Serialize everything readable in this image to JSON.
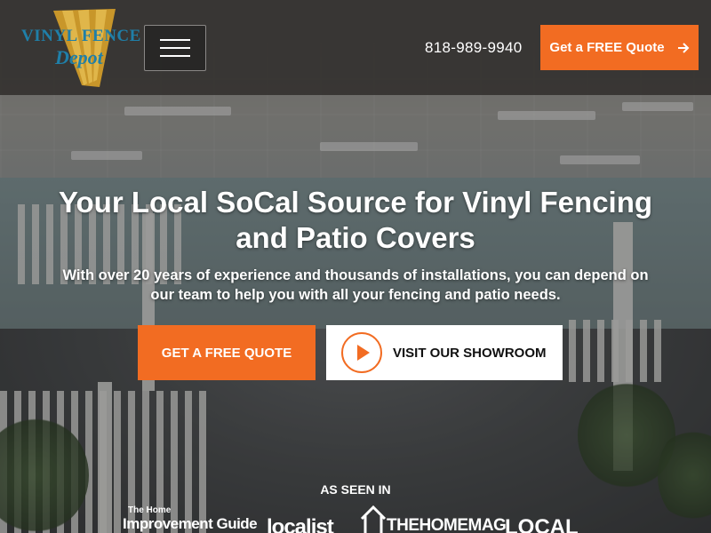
{
  "header": {
    "logo": {
      "line1": "VINYL FENCE",
      "line2": "Depot"
    },
    "phone": "818-989-9940",
    "quote_button": {
      "label": "Get a FREE Quote",
      "icon": "arrow-right-icon"
    },
    "menu_icon": "hamburger-menu-icon"
  },
  "hero": {
    "title": "Your Local SoCal Source for Vinyl Fencing and Patio Covers",
    "subtitle": "With over 20 years of experience and thousands of installations, you can depend on our team to help you with all your fencing and patio needs.",
    "primary_cta": "GET A FREE QUOTE",
    "secondary_cta": {
      "label": "VISIT OUR SHOWROOM",
      "icon": "play-icon"
    }
  },
  "as_seen_in": {
    "heading": "AS SEEN IN",
    "logos": [
      {
        "name": "home-improvement-guide",
        "line1": "The Home",
        "line2": "Improvement Guide"
      },
      {
        "name": "localist",
        "text": "localist"
      },
      {
        "name": "the-home-mag",
        "text": "THEHOMEMAG"
      },
      {
        "name": "local",
        "text": "LOCAL"
      }
    ]
  },
  "colors": {
    "accent": "#f26c22",
    "header_bg": "#343230",
    "logo_blue": "#1f7fa8",
    "logo_gold": "#c8962a"
  }
}
